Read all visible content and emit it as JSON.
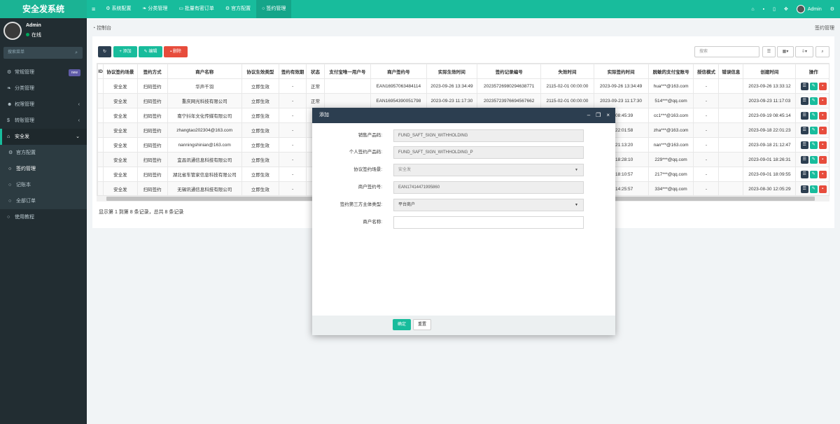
{
  "app": {
    "title": "安全发系统"
  },
  "topnav": {
    "items": [
      {
        "icon": "gear-icon",
        "label": "系统配置"
      },
      {
        "icon": "leaf-icon",
        "label": "分类管理"
      },
      {
        "icon": "card-icon",
        "label": "批量有密订单"
      },
      {
        "icon": "gear-icon",
        "label": "官方配置"
      },
      {
        "icon": "circle-icon",
        "label": "签约管理"
      }
    ],
    "user": "Admin"
  },
  "sidebar": {
    "user_name": "Admin",
    "status": "在线",
    "search_placeholder": "搜索菜单",
    "menu": [
      {
        "label": "常规管理",
        "badge": "new"
      },
      {
        "label": "分类管理"
      },
      {
        "label": "权限管理"
      },
      {
        "label": "转账管理"
      },
      {
        "label": "安全发"
      }
    ],
    "submenu": [
      {
        "label": "官方配置"
      },
      {
        "label": "签约管理"
      },
      {
        "label": "记账本"
      },
      {
        "label": "全部订单"
      }
    ],
    "last": {
      "label": "使用教程"
    }
  },
  "breadcrumb": {
    "left": "控制台",
    "right": "签约管理"
  },
  "toolbar": {
    "add": "添加",
    "edit": "编辑",
    "delete": "删除",
    "search_placeholder": "搜索"
  },
  "table": {
    "headers": [
      "ID",
      "协议签约场景",
      "签约方式",
      "商户名称",
      "协议生效类型",
      "签约有效期",
      "状态",
      "支付宝唯一用户号",
      "商户签约号",
      "实际生效时间",
      "签约记录编号",
      "失效时间",
      "实际签约时间",
      "脱敏的支付宝账号",
      "授信模式",
      "错误信息",
      "创建时间",
      "操作"
    ],
    "rows": [
      [
        "",
        "安全发",
        "扫码签约",
        "华声千羽",
        "立即生效",
        "-",
        "正常",
        "",
        "EAN16957063484114",
        "2023-09-26 13:34:49",
        "20235726980294638771",
        "2115-02-01 00:00:00",
        "2023-09-26 13:34:49",
        "hua***@163.com",
        "-",
        "",
        "2023-09-26 13:33:12"
      ],
      [
        "",
        "安全发",
        "扫码签约",
        "重庆网光科技有限公司",
        "立即生效",
        "-",
        "正常",
        "",
        "EAN16954390051798",
        "2023-09-23 11:17:30",
        "20235723976694567662",
        "2115-02-01 00:00:00",
        "2023-09-23 11:17:30",
        "514***@qq.com",
        "-",
        "",
        "2023-09-23 11:17:03"
      ],
      [
        "",
        "安全发",
        "扫码签约",
        "南宁抖年文化传媒有限公司",
        "立即生效",
        "-",
        "",
        "",
        "",
        "",
        "",
        "",
        "19 08:45:39",
        "cc1***@163.com",
        "-",
        "",
        "2023-09-19 08:45:14"
      ],
      [
        "",
        "安全发",
        "扫码签约",
        "zhangtao202304@163.com",
        "立即生效",
        "-",
        "",
        "",
        "",
        "",
        "",
        "",
        "18 22:01:58",
        "zha***@163.com",
        "-",
        "",
        "2023-09-18 22:01:23"
      ],
      [
        "",
        "安全发",
        "扫码签约",
        "nanningshinian@163.com",
        "立即生效",
        "-",
        "",
        "",
        "",
        "",
        "",
        "",
        "18 21:13:20",
        "nan***@163.com",
        "-",
        "",
        "2023-09-18 21:12:47"
      ],
      [
        "",
        "安全发",
        "扫码签约",
        "宜昌讯通信息科技有限公司",
        "立即生效",
        "-",
        "",
        "",
        "",
        "",
        "",
        "",
        "01 18:28:10",
        "229***@qq.com",
        "-",
        "",
        "2023-09-01 18:26:31"
      ],
      [
        "",
        "安全发",
        "扫码签约",
        "湖北省车管家信息科技有限公司",
        "立即生效",
        "-",
        "",
        "",
        "",
        "",
        "",
        "",
        "01 18:10:57",
        "217***@qq.com",
        "-",
        "",
        "2023-09-01 18:09:55"
      ],
      [
        "",
        "安全发",
        "扫码签约",
        "无锡讯通信息科技有限公司",
        "立即生效",
        "-",
        "",
        "",
        "",
        "",
        "",
        "",
        "30 14:25:57",
        "334***@qq.com",
        "-",
        "",
        "2023-08-30 12:05:29"
      ]
    ]
  },
  "pagination": {
    "info": "显示第 1 到第 8 条记录，总共 8 条记录"
  },
  "modal": {
    "title": "添加",
    "fields": [
      {
        "label": "销售产品码:",
        "value": "FUND_SAFT_SIGN_WITHHOLDING"
      },
      {
        "label": "个人签约产品码:",
        "value": "FUND_SAFT_SIGN_WITHHOLDING_P"
      },
      {
        "label": "协议签约场景:",
        "value": "安全发"
      },
      {
        "label": "商户签约号:",
        "value": "EAN17414471995860"
      },
      {
        "label": "签约第三方主体类型:",
        "value": "平台商户"
      },
      {
        "label": "商户名称:",
        "value": ""
      }
    ],
    "confirm": "确定",
    "reset": "重置"
  },
  "colors": {
    "accent": "#18bc9c",
    "sidebar": "#222d32",
    "modal_header": "#2c3e50",
    "danger": "#e74c3c"
  }
}
